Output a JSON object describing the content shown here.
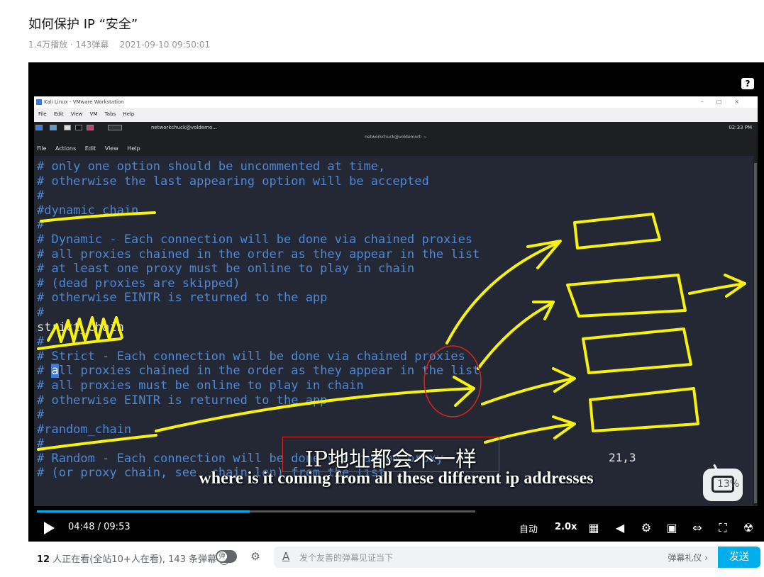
{
  "video": {
    "title": "如何保护 IP “安全”",
    "meta": "1.4万播放 · 143弹幕    2021-09-10 09:50:01"
  },
  "vmware": {
    "title": "Kali Linux - VMware Workstation",
    "menu": [
      "File",
      "Edit",
      "View",
      "VM",
      "Tabs",
      "Help"
    ],
    "taskbar_window": "networkchuck@voldemo...",
    "clock": "02:33 PM"
  },
  "terminal": {
    "title": "networkchuck@voldemort: ~",
    "menu": [
      "File",
      "Actions",
      "Edit",
      "View",
      "Help"
    ],
    "lines": [
      "# only one option should be uncommented at time,",
      "# otherwise the last appearing option will be accepted",
      "#",
      "#dynamic_chain",
      "#",
      "# Dynamic - Each connection will be done via chained proxies",
      "# all proxies chained in the order as they appear in the list",
      "# at least one proxy must be online to play in chain",
      "# (dead proxies are skipped)",
      "# otherwise EINTR is returned to the app",
      "#",
      "strict_chain",
      "#",
      "# Strict - Each connection will be done via chained proxies",
      "# all proxies chained in the order as they appear in the list",
      "# all proxies must be online to play in chain",
      "# otherwise EINTR is returned to the app",
      "#",
      "#random_chain",
      "#",
      "# Random - Each connection will be done via random proxy",
      "# (or proxy chain, see  chain_len) from the list."
    ],
    "cursor_position": "21,3"
  },
  "subtitles": {
    "chinese": "IP地址都会不一样",
    "english": "where is it coming from all these different ip addresses"
  },
  "logo_percent": "13%",
  "controls": {
    "current_time": "04:48",
    "separator": "/",
    "duration": "09:53",
    "progress_fraction": 0.485,
    "quality": "自动",
    "speed": "2.0x"
  },
  "danmaku": {
    "viewers_count": "12",
    "viewers_text": " 人正在看(全站10+人在看), 143 条弹幕",
    "toggle_label": "弹",
    "placeholder": "发个友善的弹幕见证当下",
    "etiquette": "弹幕礼仪 ›",
    "send": "发送"
  },
  "colors": {
    "accent": "#00aeec",
    "annotation": "#f7f20c",
    "circle": "#d9251c",
    "terminal_text": "#4f88d4"
  }
}
